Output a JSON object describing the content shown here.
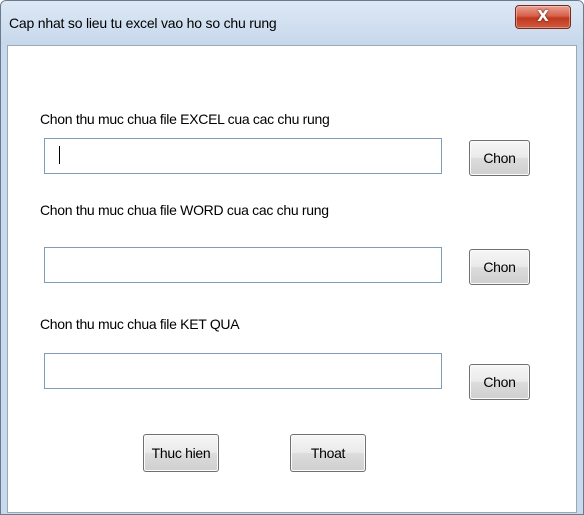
{
  "window": {
    "title": "Cap nhat so lieu tu excel vao ho so chu rung",
    "close_glyph": "X"
  },
  "fields": [
    {
      "label": "Chon thu muc chua file EXCEL cua cac chu rung",
      "value": "",
      "button_label": "Chon"
    },
    {
      "label": "Chon thu muc chua file WORD cua cac chu rung",
      "value": "",
      "button_label": "Chon"
    },
    {
      "label": "Chon thu muc chua file KET QUA",
      "value": "",
      "button_label": "Chon"
    }
  ],
  "actions": {
    "execute_label": "Thuc hien",
    "exit_label": "Thoat"
  },
  "colors": {
    "title_bar": "#c9daee",
    "close_button": "#c7432b",
    "dialog_background": "#ffffff"
  },
  "icons": {
    "close": "close-icon"
  }
}
